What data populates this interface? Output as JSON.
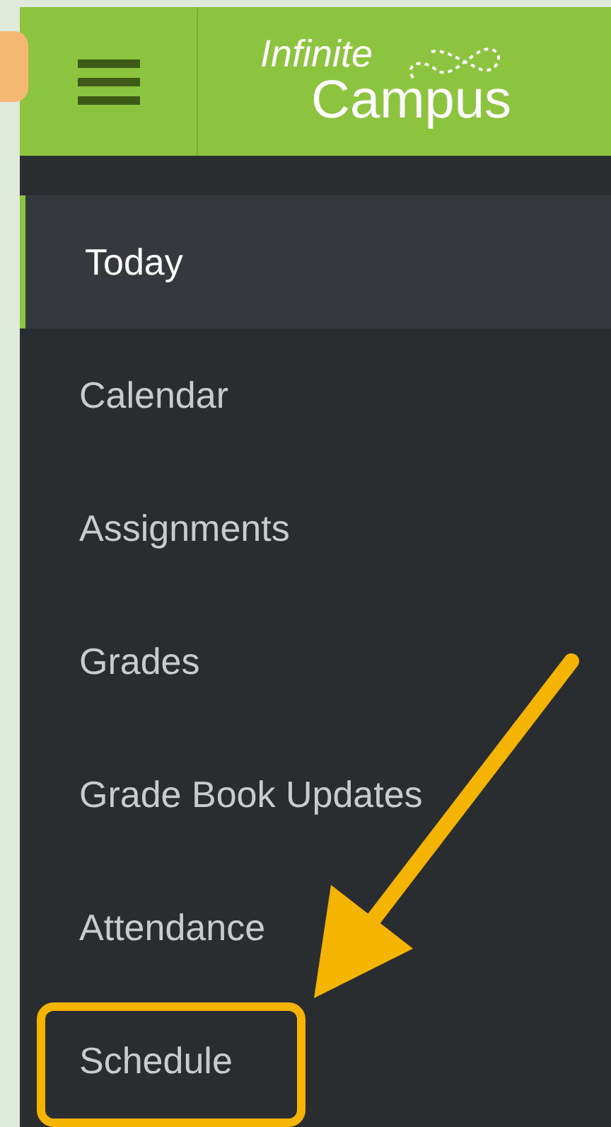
{
  "header": {
    "logo_line_1": "Infinite",
    "logo_line_2": "Campus"
  },
  "menu": {
    "items": [
      {
        "label": "Today",
        "selected": true
      },
      {
        "label": "Calendar",
        "selected": false
      },
      {
        "label": "Assignments",
        "selected": false
      },
      {
        "label": "Grades",
        "selected": false
      },
      {
        "label": "Grade Book Updates",
        "selected": false
      },
      {
        "label": "Attendance",
        "selected": false
      },
      {
        "label": "Schedule",
        "selected": false,
        "highlighted": true
      }
    ]
  }
}
